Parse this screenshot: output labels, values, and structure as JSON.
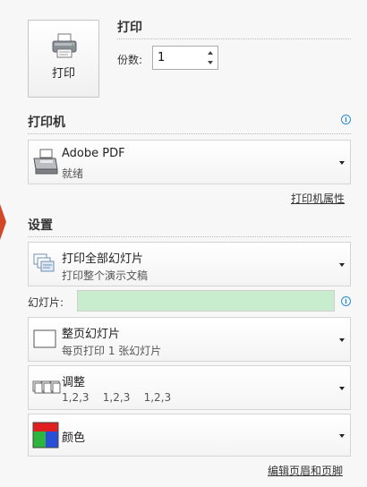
{
  "print": {
    "section_title": "打印",
    "button_label": "打印",
    "copies_label": "份数:",
    "copies_value": "1"
  },
  "printer": {
    "section_title": "打印机",
    "name": "Adobe PDF",
    "status": "就绪",
    "properties_link": "打印机属性"
  },
  "settings": {
    "section_title": "设置",
    "range": {
      "title": "打印全部幻灯片",
      "subtitle": "打印整个演示文稿"
    },
    "slides_label": "幻灯片:",
    "slides_value": "",
    "layout": {
      "title": "整页幻灯片",
      "subtitle": "每页打印 1 张幻灯片"
    },
    "collate": {
      "title": "调整",
      "subtitle": "1,2,3    1,2,3    1,2,3"
    },
    "color": {
      "title": "颜色"
    },
    "header_footer_link": "编辑页眉和页脚"
  },
  "colors": {
    "accent": "#d24726",
    "slides_field_bg": "#c7ecce",
    "info": "#2a8dd4"
  }
}
